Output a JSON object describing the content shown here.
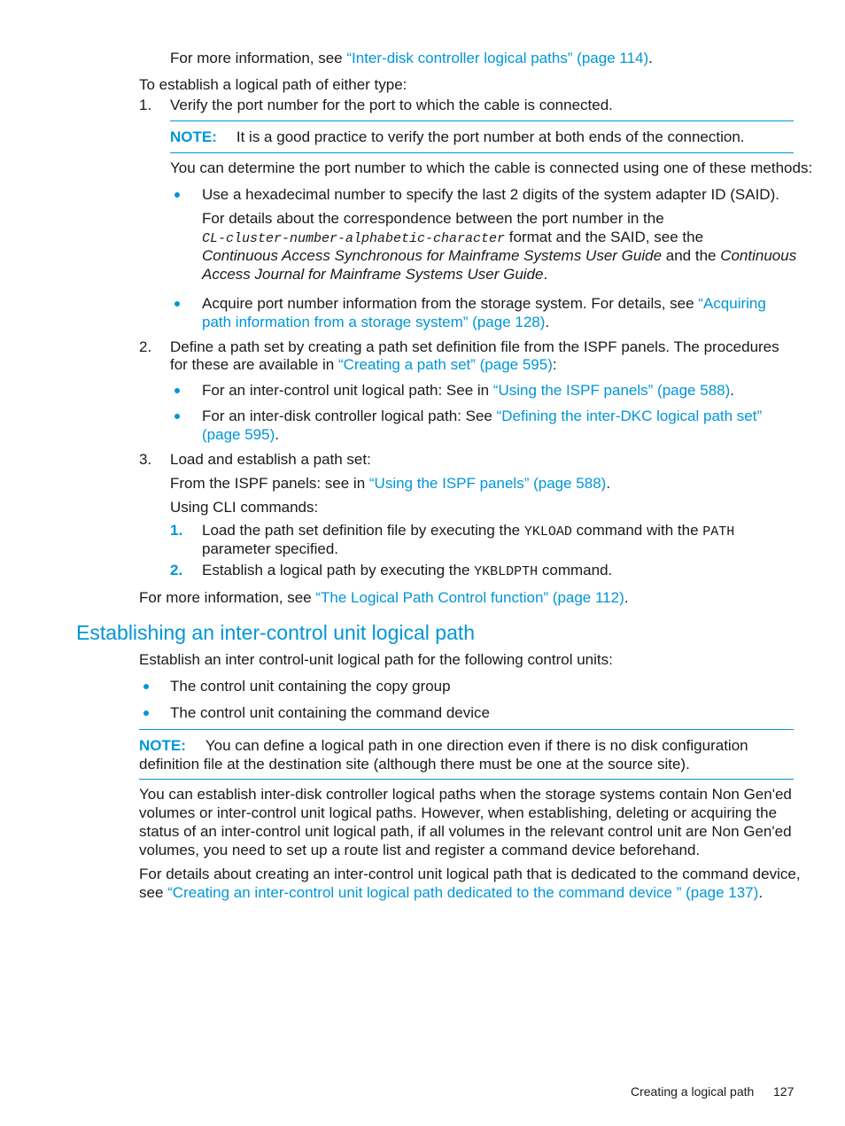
{
  "intro": {
    "more_info_prefix": "For more information, see ",
    "more_info_link": "“Inter-disk controller logical paths” (page 114)",
    "more_info_suffix": ".",
    "establish_intro": "To establish a logical path of either type:"
  },
  "steps": [
    {
      "number": "1.",
      "text": "Verify the port number for the port to which the cable is connected.",
      "note": {
        "label": "NOTE:",
        "text": "It is a good practice to verify the port number at both ends of the connection."
      },
      "methods_intro": "You can determine the port number to which the cable is connected using one of these methods:",
      "bullets": [
        {
          "text": "Use a hexadecimal number to specify the last 2 digits of the system adapter ID (SAID).",
          "detail_line1": "For details about the correspondence between the port number in the",
          "detail_code": "CL-cluster-number-alphabetic-character",
          "detail_line2_suffix": " format and the SAID, see the",
          "detail_italic1": "Continuous Access Synchronous for Mainframe Systems User Guide",
          "detail_and": " and the ",
          "detail_italic2a": "Continuous",
          "detail_italic2b": "Access Journal for Mainframe Systems User Guide",
          "detail_end": "."
        },
        {
          "text_prefix": "Acquire port number information from the storage system. For details, see ",
          "link_line1": "“Acquiring",
          "link_line2": "path information from a storage system” (page 128)",
          "suffix": "."
        }
      ]
    },
    {
      "number": "2.",
      "text_line1": "Define a path set by creating a path set definition file from the ISPF panels. The procedures",
      "text_line2_prefix": "for these are available in ",
      "text_line2_link": "“Creating a path set” (page 595)",
      "text_line2_suffix": ":",
      "bullets": [
        {
          "prefix": "For an inter-control unit logical path: See in ",
          "link": "“Using the ISPF panels” (page 588)",
          "suffix": "."
        },
        {
          "prefix": "For an inter-disk controller logical path: See ",
          "link_line1": "“Defining the inter-DKC logical path set”",
          "link_line2": "(page 595)",
          "suffix": "."
        }
      ]
    },
    {
      "number": "3.",
      "text": "Load and establish a path set:",
      "ispf_prefix": "From the ISPF panels: see in ",
      "ispf_link": "“Using the ISPF panels” (page 588)",
      "ispf_suffix": ".",
      "cli_intro": "Using CLI commands:",
      "substeps": [
        {
          "number": "1.",
          "prefix": "Load the path set definition file by executing the ",
          "code1": "YKLOAD",
          "middle": " command with the ",
          "code2": "PATH",
          "line2": "parameter specified."
        },
        {
          "number": "2.",
          "prefix": "Establish a logical path by executing the ",
          "code1": "YKBLDPTH",
          "suffix": " command."
        }
      ]
    }
  ],
  "outro": {
    "prefix": "For more information, see ",
    "link": "“The Logical Path Control function” (page 112)",
    "suffix": "."
  },
  "section": {
    "heading": "Establishing an inter-control unit logical path",
    "intro": "Establish an inter control-unit logical path for the following control units:",
    "bullets": [
      "The control unit containing the copy group",
      "The control unit containing the command device"
    ],
    "note": {
      "label": "NOTE:",
      "line1": "You can define a logical path in one direction even if there is no disk configuration",
      "line2": "definition file at the destination site (although there must be one at the source site)."
    },
    "para1": [
      "You can establish inter-disk controller logical paths when the storage systems contain Non Gen'ed",
      "volumes or inter-control unit logical paths. However, when establishing, deleting or acquiring the",
      "status of an inter-control unit logical path, if all volumes in the relevant control unit are Non Gen'ed",
      "volumes, you need to set up a route list and register a command device beforehand."
    ],
    "para2_line1": "For details about creating an inter-control unit logical path that is dedicated to the command device,",
    "para2_prefix": "see ",
    "para2_link": "“Creating an inter-control unit logical path dedicated to the command device ” (page 137)",
    "para2_suffix": "."
  },
  "footer": {
    "section_title": "Creating a logical path",
    "page_number": "127"
  },
  "colors": {
    "accent": "#0096d6",
    "text": "#1a1a1a"
  }
}
